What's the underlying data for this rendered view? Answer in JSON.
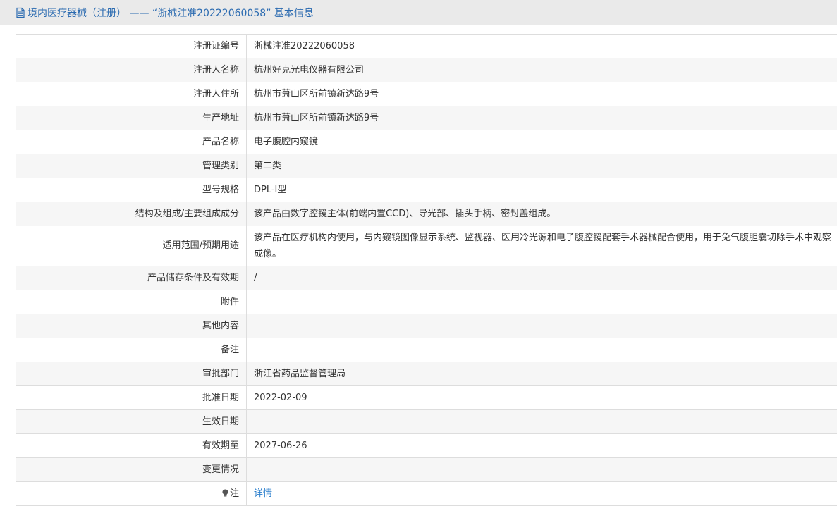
{
  "header": {
    "title": "境内医疗器械（注册） ——  “浙械注准20222060058”  基本信息",
    "icon": "document-icon"
  },
  "rows": [
    {
      "label": "注册证编号",
      "value": "浙械注准20222060058"
    },
    {
      "label": "注册人名称",
      "value": "杭州好克光电仪器有限公司"
    },
    {
      "label": "注册人住所",
      "value": "杭州市萧山区所前镇新达路9号"
    },
    {
      "label": "生产地址",
      "value": "杭州市萧山区所前镇新达路9号"
    },
    {
      "label": "产品名称",
      "value": "电子腹腔内窥镜"
    },
    {
      "label": "管理类别",
      "value": "第二类"
    },
    {
      "label": "型号规格",
      "value": "DPL-Ⅰ型"
    },
    {
      "label": "结构及组成/主要组成成分",
      "value": "该产品由数字腔镜主体(前端内置CCD)、导光部、插头手柄、密封盖组成。"
    },
    {
      "label": "适用范围/预期用途",
      "value": "该产品在医疗机构内使用，与内窥镜图像显示系统、监视器、医用冷光源和电子腹腔镜配套手术器械配合使用，用于免气腹胆囊切除手术中观察成像。"
    },
    {
      "label": "产品储存条件及有效期",
      "value": "/"
    },
    {
      "label": "附件",
      "value": ""
    },
    {
      "label": "其他内容",
      "value": ""
    },
    {
      "label": "备注",
      "value": ""
    },
    {
      "label": "审批部门",
      "value": "浙江省药品监督管理局"
    },
    {
      "label": "批准日期",
      "value": "2022-02-09"
    },
    {
      "label": "生效日期",
      "value": ""
    },
    {
      "label": "有效期至",
      "value": "2027-06-26"
    },
    {
      "label": "变更情况",
      "value": ""
    },
    {
      "label": "注",
      "value": "详情"
    }
  ],
  "colors": {
    "header_bg": "#eaeaea",
    "title": "#2a6ab0",
    "link": "#2a7ecc",
    "row_alt": "#f6f6f6",
    "border": "#dddddd"
  },
  "icons": {
    "note_icon": "lightbulb-icon"
  }
}
